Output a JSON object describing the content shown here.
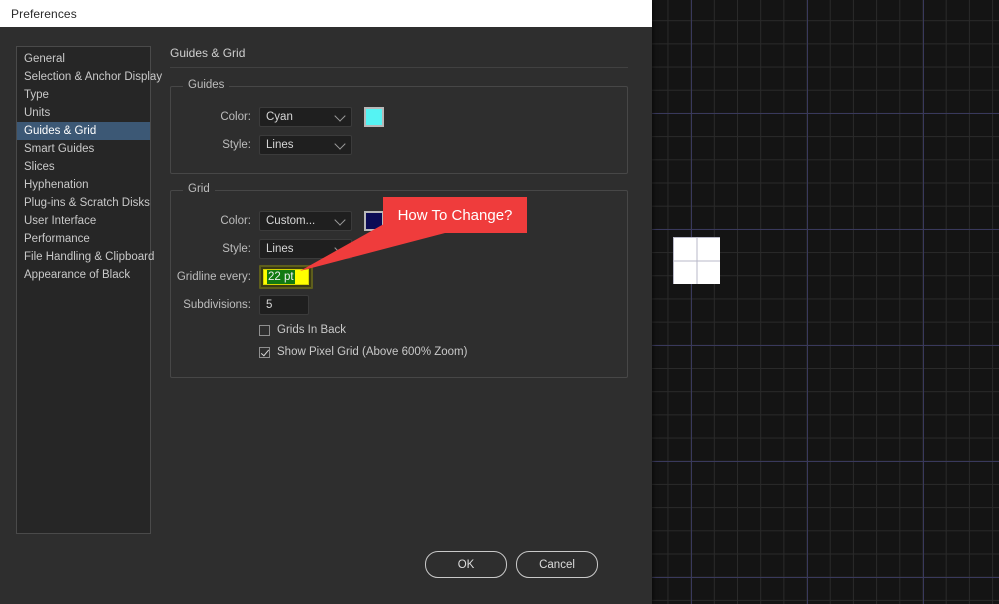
{
  "window": {
    "title": "Preferences"
  },
  "sidebar": {
    "items": [
      {
        "label": "General",
        "selected": false
      },
      {
        "label": "Selection & Anchor Display",
        "selected": false
      },
      {
        "label": "Type",
        "selected": false
      },
      {
        "label": "Units",
        "selected": false
      },
      {
        "label": "Guides & Grid",
        "selected": true
      },
      {
        "label": "Smart Guides",
        "selected": false
      },
      {
        "label": "Slices",
        "selected": false
      },
      {
        "label": "Hyphenation",
        "selected": false
      },
      {
        "label": "Plug-ins & Scratch Disks",
        "selected": false
      },
      {
        "label": "User Interface",
        "selected": false
      },
      {
        "label": "Performance",
        "selected": false
      },
      {
        "label": "File Handling & Clipboard",
        "selected": false
      },
      {
        "label": "Appearance of Black",
        "selected": false
      }
    ]
  },
  "pane": {
    "title": "Guides & Grid",
    "guides": {
      "legend": "Guides",
      "color_label": "Color:",
      "color_value": "Cyan",
      "color_swatch": "#55f3f3",
      "style_label": "Style:",
      "style_value": "Lines"
    },
    "grid": {
      "legend": "Grid",
      "color_label": "Color:",
      "color_value": "Custom...",
      "color_swatch": "#0b0b55",
      "style_label": "Style:",
      "style_value": "Lines",
      "gridline_label": "Gridline every:",
      "gridline_value": "22 pt",
      "subdivisions_label": "Subdivisions:",
      "subdivisions_value": "5",
      "grids_in_back_label": "Grids In Back",
      "grids_in_back_checked": false,
      "show_pixel_grid_label": "Show Pixel Grid (Above 600% Zoom)",
      "show_pixel_grid_checked": true
    }
  },
  "callout": {
    "text": "How To Change?",
    "color": "#ef3c3c"
  },
  "footer": {
    "ok_label": "OK",
    "cancel_label": "Cancel"
  }
}
